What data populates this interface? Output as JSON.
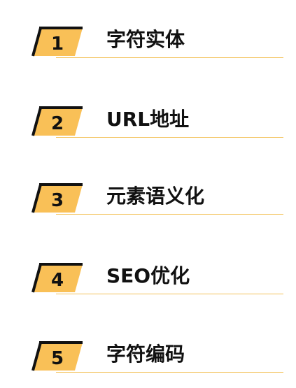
{
  "accent_color": "#f3c25a",
  "toc": {
    "items": [
      {
        "number": "1",
        "label": "字符实体"
      },
      {
        "number": "2",
        "label": "URL地址"
      },
      {
        "number": "3",
        "label": "元素语义化"
      },
      {
        "number": "4",
        "label": "SEO优化"
      },
      {
        "number": "5",
        "label": "字符编码"
      }
    ]
  }
}
